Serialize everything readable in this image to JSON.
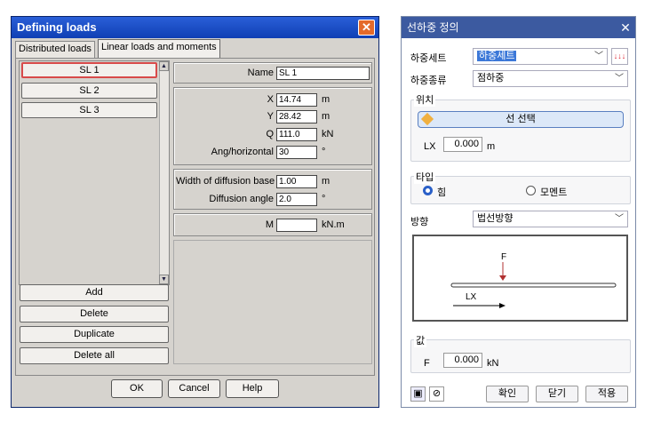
{
  "left_dialog": {
    "title": "Defining loads",
    "tabs": [
      "Distributed loads",
      "Linear loads and moments"
    ],
    "list_items": [
      "SL 1",
      "SL 2",
      "SL 3"
    ],
    "actions": {
      "add": "Add",
      "delete": "Delete",
      "duplicate": "Duplicate",
      "delete_all": "Delete all"
    },
    "name": {
      "label": "Name",
      "value": "SL 1"
    },
    "x": {
      "label": "X",
      "value": "14.74",
      "unit": "m"
    },
    "y": {
      "label": "Y",
      "value": "28.42",
      "unit": "m"
    },
    "q": {
      "label": "Q",
      "value": "111.0",
      "unit": "kN"
    },
    "ang": {
      "label": "Ang/horizontal",
      "value": "30",
      "unit": "°"
    },
    "wdb": {
      "label": "Width of diffusion base",
      "value": "1.00",
      "unit": "m"
    },
    "da": {
      "label": "Diffusion angle",
      "value": "2.0",
      "unit": "°"
    },
    "m": {
      "label": "M",
      "value": "",
      "unit": "kN.m"
    },
    "buttons": {
      "ok": "OK",
      "cancel": "Cancel",
      "help": "Help"
    }
  },
  "right_dialog": {
    "title": "선하중 정의",
    "load_set": {
      "label": "하중세트",
      "value": "하중세트"
    },
    "load_type": {
      "label": "하중종류",
      "value": "점하중"
    },
    "position": {
      "group": "위치",
      "select_line": "선 선택",
      "lx_label": "LX",
      "lx_value": "0.000",
      "lx_unit": "m"
    },
    "type_group": {
      "label": "타입",
      "force": "힘",
      "moment": "모멘트"
    },
    "direction": {
      "label": "방향",
      "value": "법선방향"
    },
    "diagram": {
      "f_label": "F",
      "lx_label": "LX"
    },
    "value_group": {
      "label": "값",
      "f_label": "F",
      "f_value": "0.000",
      "f_unit": "kN"
    },
    "buttons": {
      "ok": "확인",
      "close": "닫기",
      "apply": "적용"
    }
  }
}
